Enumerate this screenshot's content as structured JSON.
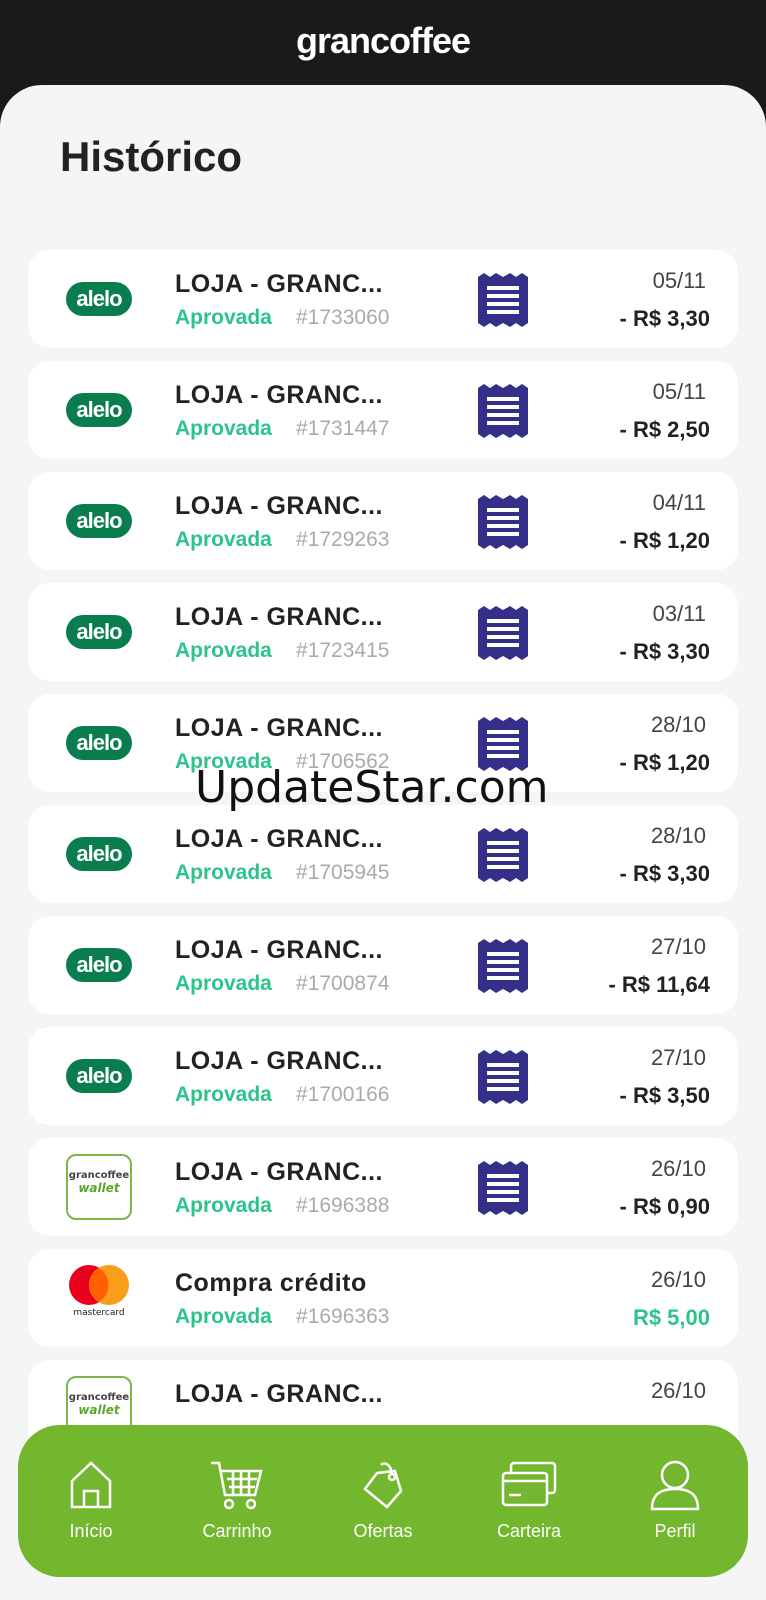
{
  "header": {
    "brand": "grancoffee"
  },
  "page": {
    "title": "Histórico"
  },
  "transactions": [
    {
      "logo": "alelo",
      "logo_text": "alelo",
      "title": "LOJA - GRANC...",
      "status": "Aprovada",
      "code": "#1733060",
      "date": "05/11",
      "amount": "- R$ 3,30",
      "has_receipt": true,
      "credit": false
    },
    {
      "logo": "alelo",
      "logo_text": "alelo",
      "title": "LOJA - GRANC...",
      "status": "Aprovada",
      "code": "#1731447",
      "date": "05/11",
      "amount": "- R$ 2,50",
      "has_receipt": true,
      "credit": false
    },
    {
      "logo": "alelo",
      "logo_text": "alelo",
      "title": "LOJA - GRANC...",
      "status": "Aprovada",
      "code": "#1729263",
      "date": "04/11",
      "amount": "- R$ 1,20",
      "has_receipt": true,
      "credit": false
    },
    {
      "logo": "alelo",
      "logo_text": "alelo",
      "title": "LOJA - GRANC...",
      "status": "Aprovada",
      "code": "#1723415",
      "date": "03/11",
      "amount": "- R$ 3,30",
      "has_receipt": true,
      "credit": false
    },
    {
      "logo": "alelo",
      "logo_text": "alelo",
      "title": "LOJA - GRANC...",
      "status": "Aprovada",
      "code": "#1706562",
      "date": "28/10",
      "amount": "- R$ 1,20",
      "has_receipt": true,
      "credit": false
    },
    {
      "logo": "alelo",
      "logo_text": "alelo",
      "title": "LOJA - GRANC...",
      "status": "Aprovada",
      "code": "#1705945",
      "date": "28/10",
      "amount": "- R$ 3,30",
      "has_receipt": true,
      "credit": false
    },
    {
      "logo": "alelo",
      "logo_text": "alelo",
      "title": "LOJA - GRANC...",
      "status": "Aprovada",
      "code": "#1700874",
      "date": "27/10",
      "amount": "- R$ 11,64",
      "has_receipt": true,
      "credit": false
    },
    {
      "logo": "alelo",
      "logo_text": "alelo",
      "title": "LOJA - GRANC...",
      "status": "Aprovada",
      "code": "#1700166",
      "date": "27/10",
      "amount": "- R$ 3,50",
      "has_receipt": true,
      "credit": false
    },
    {
      "logo": "grancoffee-wallet",
      "logo_text": "grancoffee",
      "logo_subtext": "wallet",
      "title": "LOJA - GRANC...",
      "status": "Aprovada",
      "code": "#1696388",
      "date": "26/10",
      "amount": "- R$ 0,90",
      "has_receipt": true,
      "credit": false
    },
    {
      "logo": "mastercard",
      "logo_text": "mastercard",
      "title": "Compra crédito",
      "status": "Aprovada",
      "code": "#1696363",
      "date": "26/10",
      "amount": "R$ 5,00",
      "has_receipt": false,
      "credit": true
    },
    {
      "logo": "grancoffee-wallet",
      "logo_text": "grancoffee",
      "logo_subtext": "wallet",
      "title": "LOJA - GRANC...",
      "status": "",
      "code": "",
      "date": "26/10",
      "amount": "",
      "has_receipt": false,
      "credit": false
    }
  ],
  "watermark": "UpdateStar.com",
  "nav": [
    {
      "label": "Início",
      "icon": "home-icon"
    },
    {
      "label": "Carrinho",
      "icon": "cart-icon"
    },
    {
      "label": "Ofertas",
      "icon": "tag-icon"
    },
    {
      "label": "Carteira",
      "icon": "wallet-cards-icon"
    },
    {
      "label": "Perfil",
      "icon": "user-icon"
    }
  ],
  "colors": {
    "accent_green": "#72b72e",
    "status_green": "#2cc48a",
    "alelo_green": "#0a7d4f",
    "receipt_blue": "#34308a"
  }
}
